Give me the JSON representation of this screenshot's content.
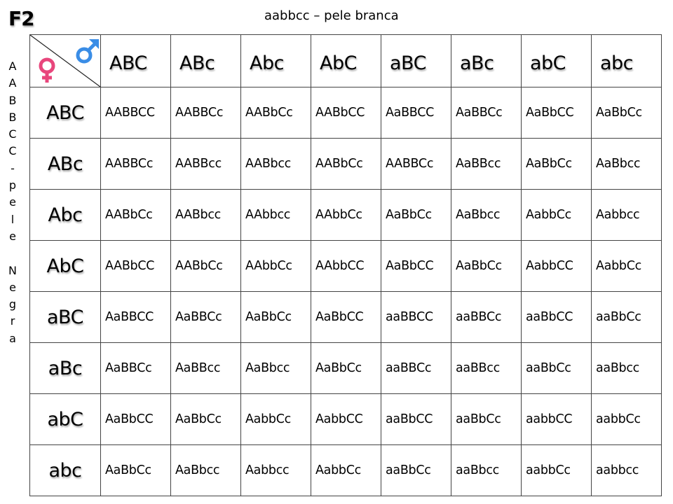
{
  "title": "F2",
  "subtitle": "aabbcc – pele branca",
  "side_label": [
    "A",
    "A",
    "B",
    "B",
    "C",
    "C",
    "-",
    "p",
    "e",
    "l",
    "e",
    "",
    "N",
    "e",
    "g",
    "r",
    "a"
  ],
  "corner": {
    "female_icon": "female-symbol",
    "male_icon": "male-symbol",
    "female_color": "#e8467c",
    "male_color": "#3a8de6"
  },
  "male_gametes": [
    "ABC",
    "ABc",
    "Abc",
    "AbC",
    "aBC",
    "aBc",
    "abC",
    "abc"
  ],
  "rows": [
    {
      "gamete": "ABC",
      "cells": [
        "AABBCC",
        "AABBCc",
        "AABbCc",
        "AABbCC",
        "AaBBCC",
        "AaBBCc",
        "AaBbCC",
        "AaBbCc"
      ]
    },
    {
      "gamete": "ABc",
      "cells": [
        "AABBCc",
        "AABBcc",
        "AABbcc",
        "AABbCc",
        "AABBCc",
        "AaBBcc",
        "AaBbCc",
        "AaBbcc"
      ]
    },
    {
      "gamete": "Abc",
      "cells": [
        "AABbCc",
        "AABbcc",
        "AAbbcc",
        "AAbbCc",
        "AaBbCc",
        "AaBbcc",
        "AabbCc",
        "Aabbcc"
      ]
    },
    {
      "gamete": "AbC",
      "cells": [
        "AABbCC",
        "AABbCc",
        "AAbbCc",
        "AAbbCC",
        "AaBbCC",
        "AaBbCc",
        "AabbCC",
        "AabbCc"
      ]
    },
    {
      "gamete": "aBC",
      "cells": [
        "AaBBCC",
        "AaBBCc",
        "AaBbCc",
        "AaBbCC",
        "aaBBCC",
        "aaBBCc",
        "aaBbCC",
        "aaBbCc"
      ]
    },
    {
      "gamete": "aBc",
      "cells": [
        "AaBBCc",
        "AaBBcc",
        "AaBbcc",
        "AaBbCc",
        "aaBBCc",
        "aaBBcc",
        "aaBbCc",
        "aaBbcc"
      ]
    },
    {
      "gamete": "abC",
      "cells": [
        "AaBbCC",
        "AaBbCc",
        "AabbCc",
        "AabbCC",
        "aaBbCC",
        "aaBbCc",
        "aabbCC",
        "aabbCc"
      ]
    },
    {
      "gamete": "abc",
      "cells": [
        "AaBbCc",
        "AaBbcc",
        "Aabbcc",
        "AabbCc",
        "aaBbCc",
        "aaBbcc",
        "aabbCc",
        "aabbcc"
      ]
    }
  ]
}
